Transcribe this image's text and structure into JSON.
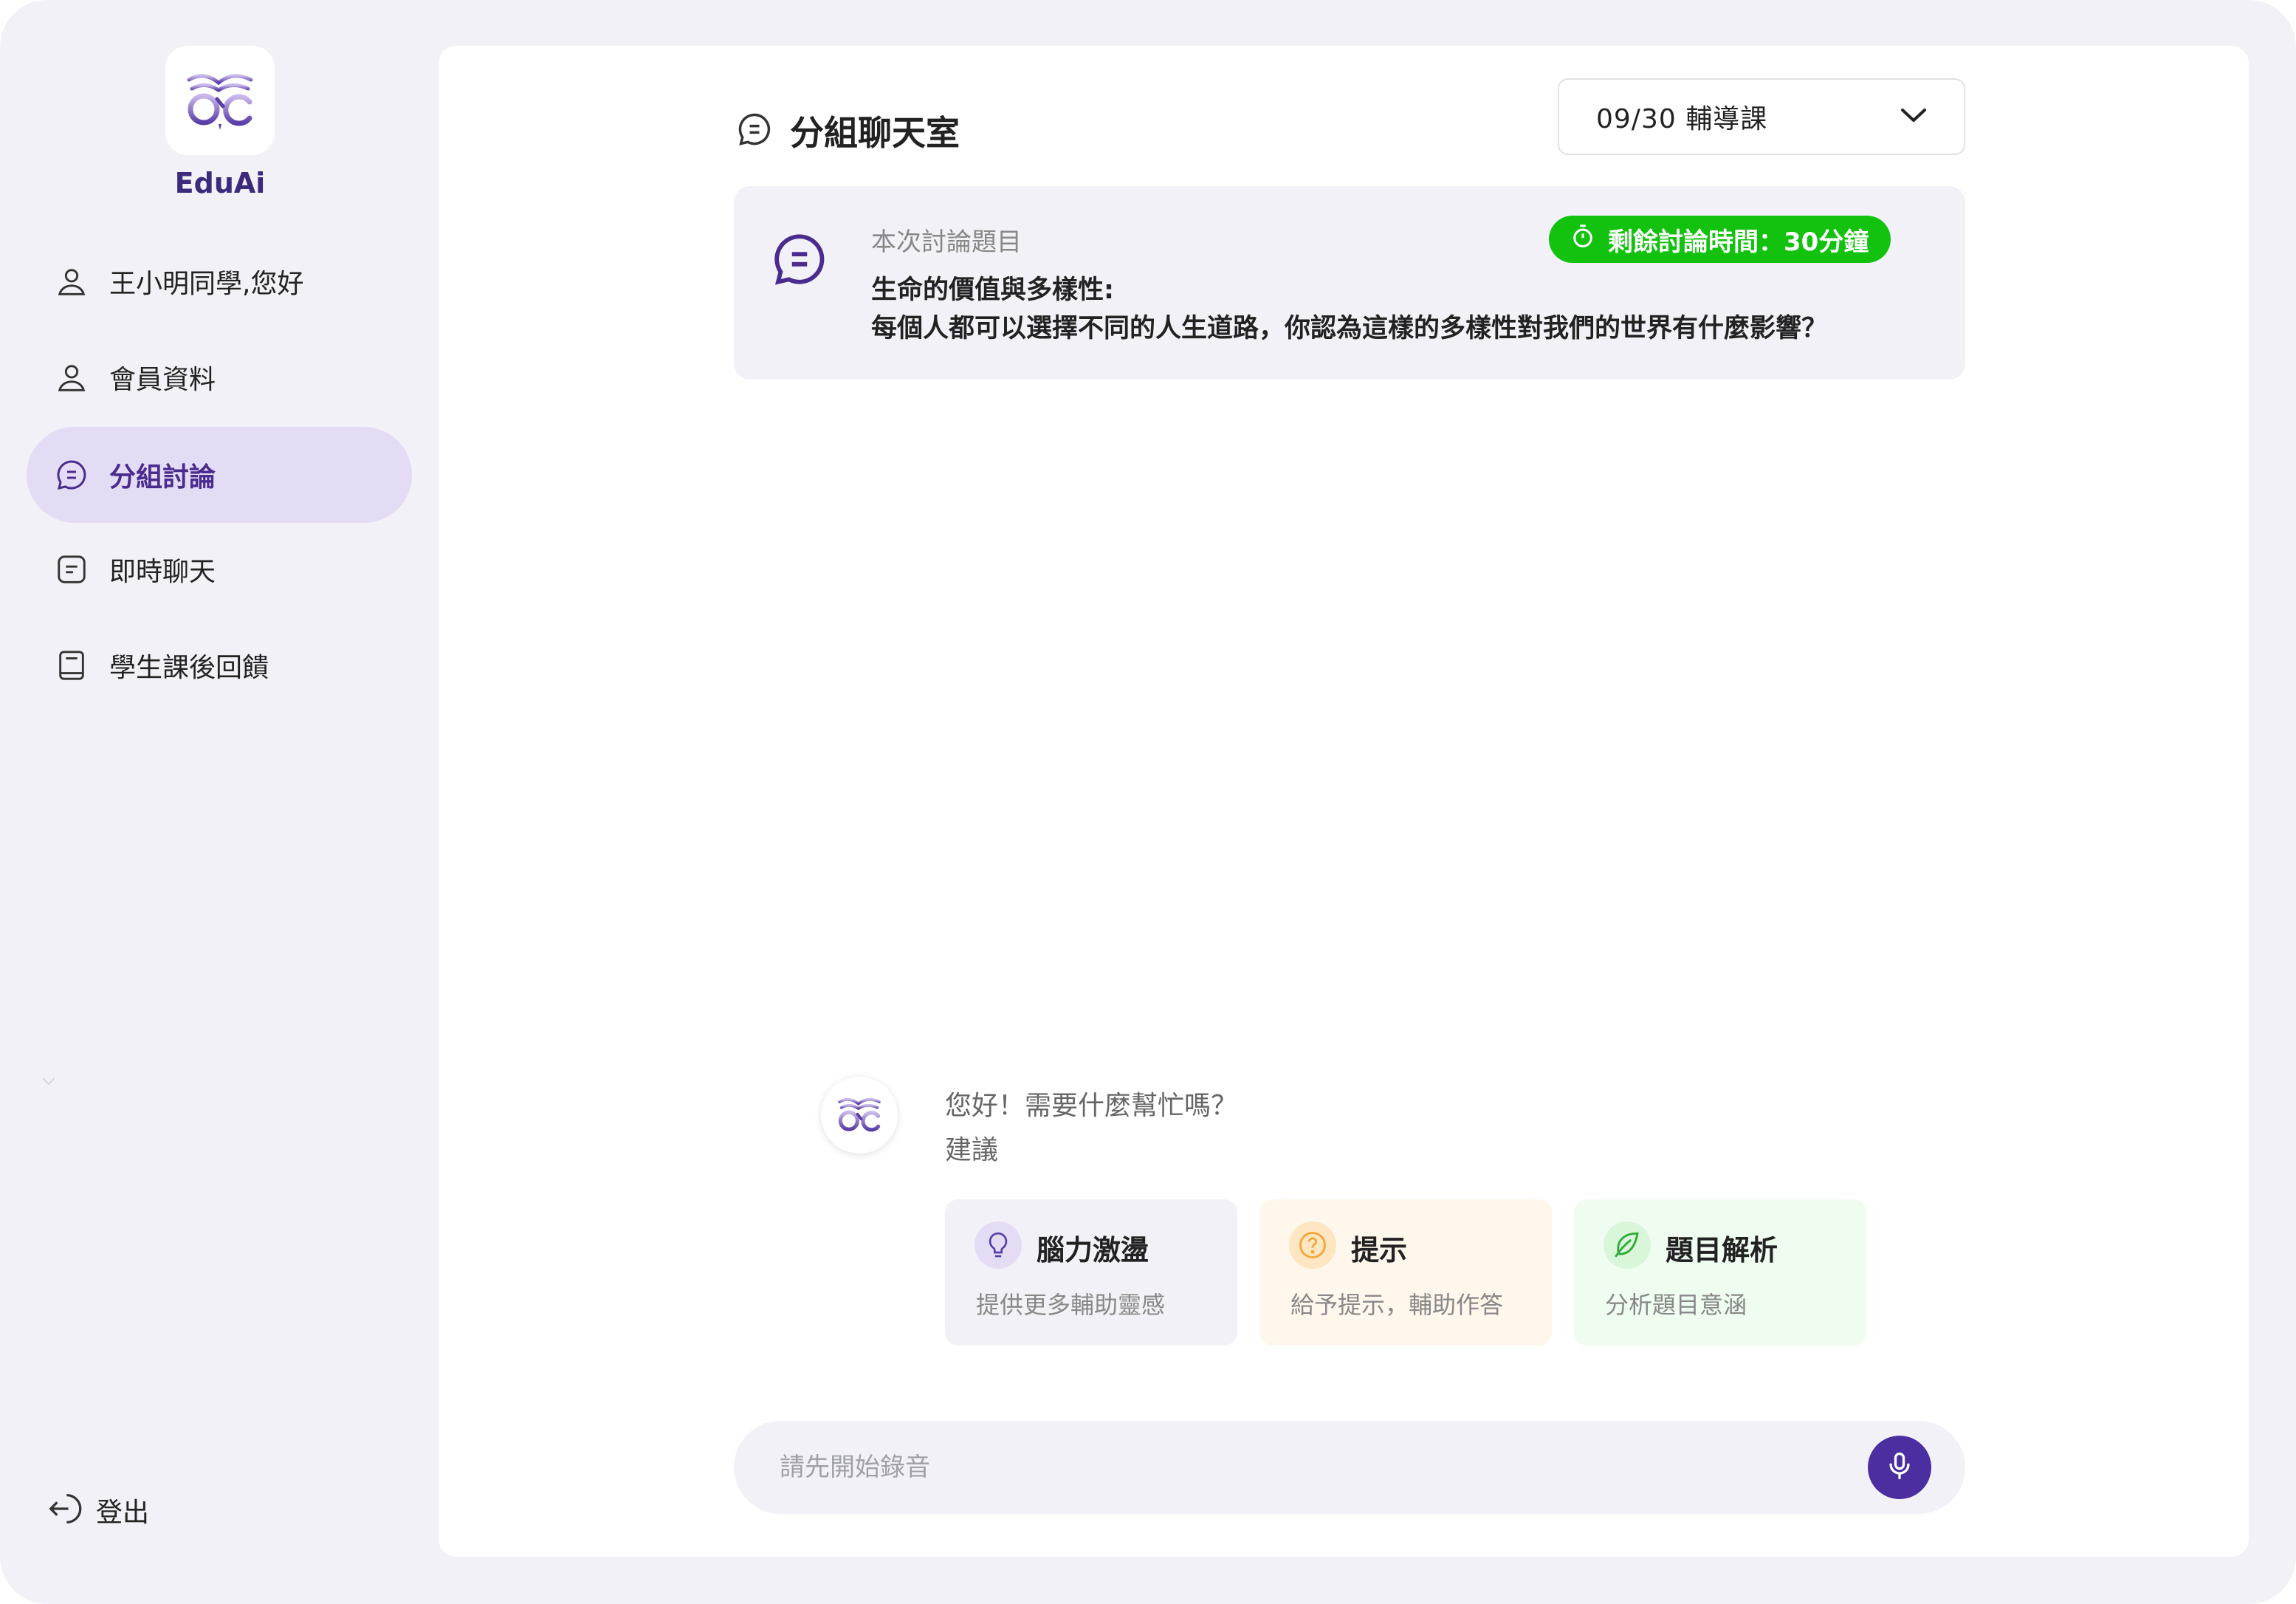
{
  "brand": {
    "name": "EduAi"
  },
  "sidebar": {
    "items": [
      {
        "label": "王小明同學,您好",
        "icon": "user-icon"
      },
      {
        "label": "會員資料",
        "icon": "user-icon"
      },
      {
        "label": "分組討論",
        "icon": "chat-bubble-icon",
        "active": true
      },
      {
        "label": "即時聊天",
        "icon": "message-square-icon"
      },
      {
        "label": "學生課後回饋",
        "icon": "book-icon"
      }
    ],
    "logout_label": "登出"
  },
  "header": {
    "title": "分組聊天室",
    "session_select": {
      "value": "09/30 輔導課"
    }
  },
  "topic": {
    "caption": "本次討論題目",
    "line1": "生命的價值與多樣性:",
    "line2": "每個人都可以選擇不同的人生道路，你認為這樣的多樣性對我們的世界有什麼影響？",
    "timer": "剩餘討論時間：30分鐘"
  },
  "assistant": {
    "greeting": "您好！需要什麼幫忙嗎？",
    "suggest_label": "建議",
    "suggestions": [
      {
        "title": "腦力激盪",
        "desc": "提供更多輔助靈感",
        "icon": "lightbulb-icon"
      },
      {
        "title": "提示",
        "desc": "給予提示，輔助作答",
        "icon": "question-circle-icon"
      },
      {
        "title": "題目解析",
        "desc": "分析題目意涵",
        "icon": "leaf-icon"
      }
    ]
  },
  "input": {
    "placeholder": "請先開始錄音"
  },
  "colors": {
    "accent": "#4b2ea0",
    "active_bg": "#e4dcf4",
    "timer_green": "#13c20f",
    "panel_bg": "#f2f1f7"
  }
}
